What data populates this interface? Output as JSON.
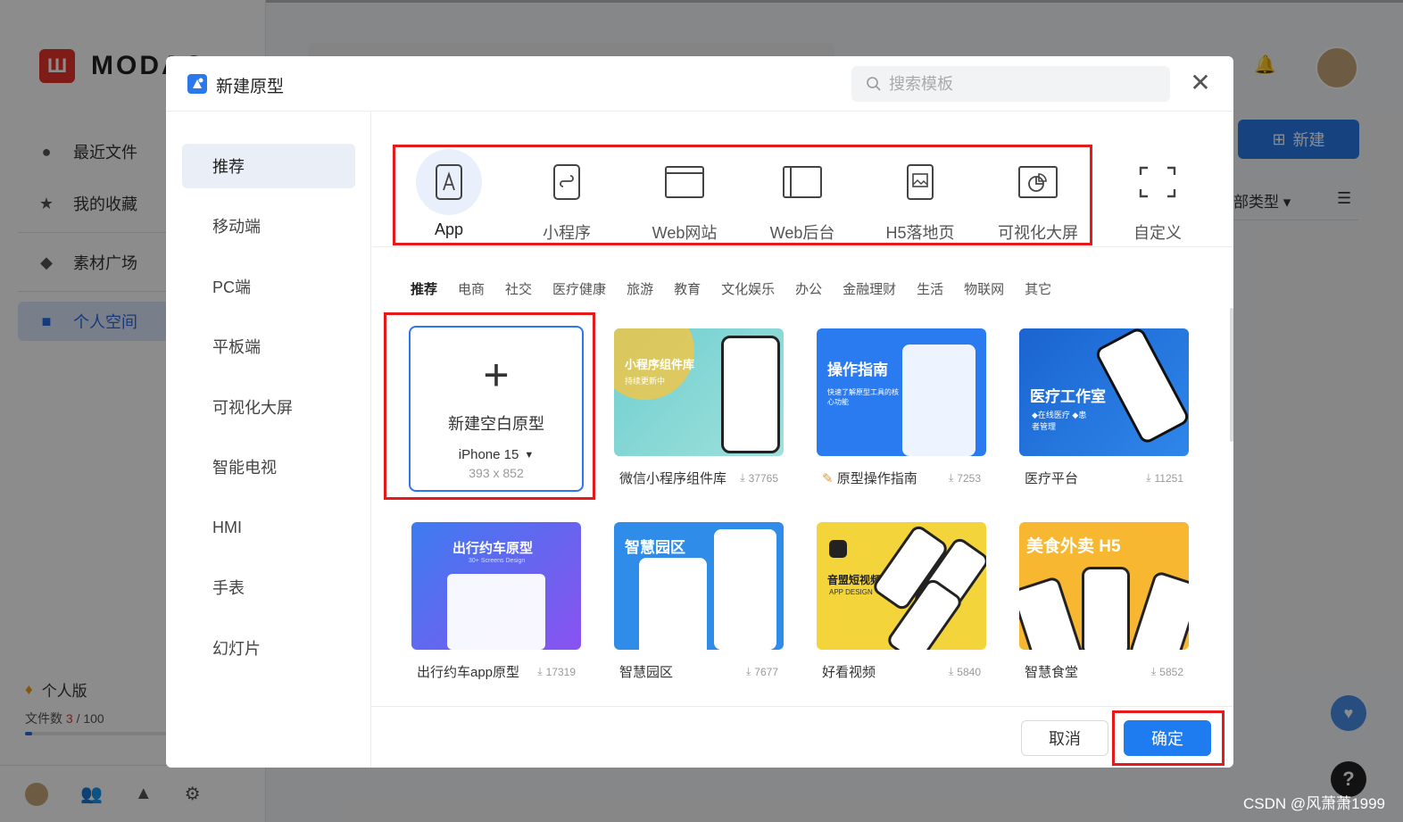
{
  "background": {
    "logo_text": "MODAO",
    "nav": [
      {
        "label": "最近文件",
        "icon": "clock-icon"
      },
      {
        "label": "我的收藏",
        "icon": "star-icon"
      },
      {
        "label": "素材广场",
        "icon": "shapes-icon"
      },
      {
        "label": "个人空间",
        "icon": "cube-icon"
      }
    ],
    "plan_label": "个人版",
    "files_label": "文件数",
    "files_used": "3",
    "files_total": "/ 100",
    "files_progress": 0.03,
    "new_button": "新建",
    "type_filter": "部类型",
    "watermark": "CSDN @风萧萧1999"
  },
  "dialog": {
    "title": "新建原型",
    "search_placeholder": "搜索模板",
    "left_menu": [
      "推荐",
      "移动端",
      "PC端",
      "平板端",
      "可视化大屏",
      "智能电视",
      "HMI",
      "手表",
      "幻灯片"
    ],
    "types": [
      {
        "label": "App",
        "icon": "app-icon"
      },
      {
        "label": "小程序",
        "icon": "mini-program-icon"
      },
      {
        "label": "Web网站",
        "icon": "web-icon"
      },
      {
        "label": "Web后台",
        "icon": "web-admin-icon"
      },
      {
        "label": "H5落地页",
        "icon": "h5-icon"
      },
      {
        "label": "可视化大屏",
        "icon": "dashboard-icon"
      },
      {
        "label": "自定义",
        "icon": "custom-icon"
      }
    ],
    "categories": [
      "推荐",
      "电商",
      "社交",
      "医疗健康",
      "旅游",
      "教育",
      "文化娱乐",
      "办公",
      "金融理财",
      "生活",
      "物联网",
      "其它"
    ],
    "blank": {
      "title": "新建空白原型",
      "device": "iPhone 15",
      "size": "393 x 852"
    },
    "templates": [
      {
        "name": "微信小程序组件库",
        "count": "37765",
        "thumb_title": "小程序组件库",
        "thumb_sub": "持续更新中",
        "color": "#7fd3d3"
      },
      {
        "name": "原型操作指南",
        "count": "7253",
        "thumb_title": "操作指南",
        "thumb_sub": "快速了解原型工具的核心功能",
        "color": "#2b7bf0"
      },
      {
        "name": "医疗平台",
        "count": "11251",
        "thumb_title": "医疗工作室",
        "thumb_sub": "◆在线医疗 ◆患者管理",
        "color": "#1f6fd6"
      },
      {
        "name": "出行约车app原型",
        "count": "17319",
        "thumb_title": "出行约车原型",
        "thumb_sub": "30+ Screens Design",
        "color": "#5a5ff0"
      },
      {
        "name": "智慧园区",
        "count": "7677",
        "thumb_title": "智慧园区",
        "thumb_sub": "",
        "color": "#2f8ce8"
      },
      {
        "name": "好看视频",
        "count": "5840",
        "thumb_title": "音盟短视频",
        "thumb_sub": "APP DESIGN",
        "color": "#f3d43a"
      },
      {
        "name": "智慧食堂",
        "count": "5852",
        "thumb_title": "美食外卖 H5",
        "thumb_sub": "",
        "color": "#f7b731"
      }
    ],
    "cancel_label": "取消",
    "ok_label": "确定"
  }
}
